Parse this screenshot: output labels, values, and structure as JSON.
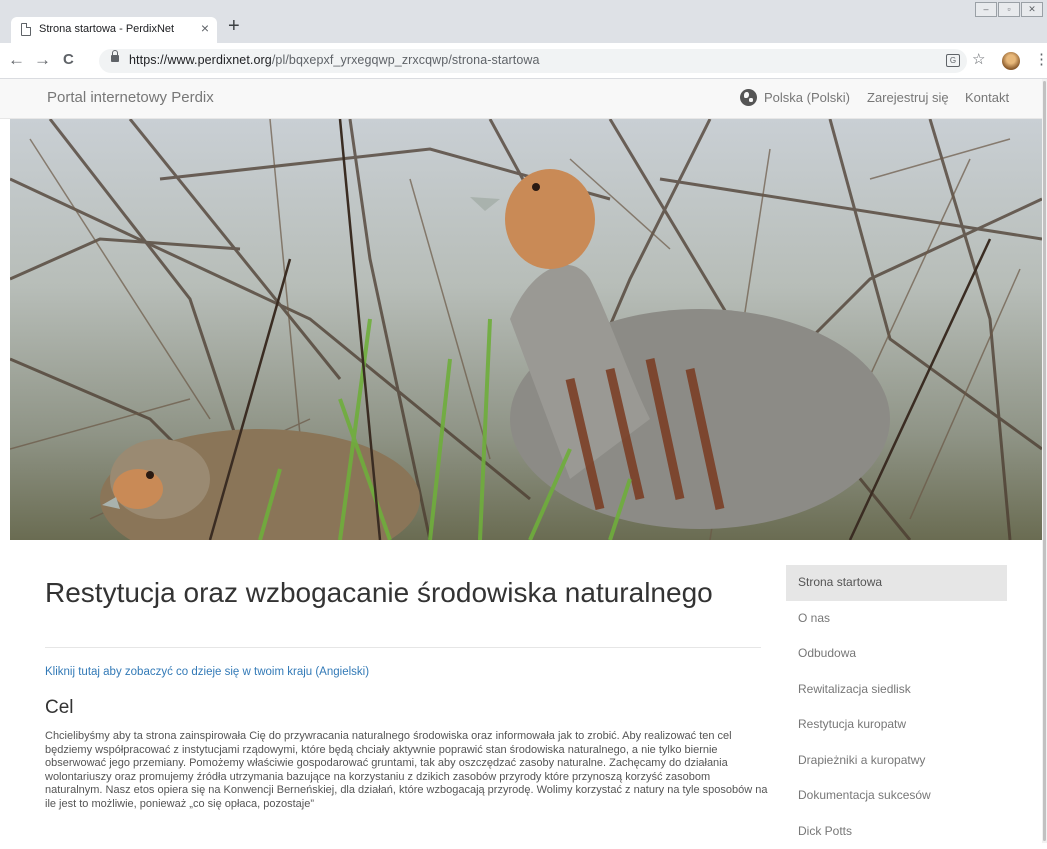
{
  "browser": {
    "tab_title": "Strona startowa - PerdixNet",
    "tab_close": "×",
    "new_tab": "+",
    "url_host": "https://www.perdixnet.org",
    "url_path": "/pl/bqxepxf_yrxegqwp_zrxcqwp/strona-startowa",
    "nav": {
      "back": "←",
      "forward": "→",
      "reload": "C"
    },
    "icons": {
      "star": "☆",
      "menu": "⋮",
      "translate": "G"
    }
  },
  "site": {
    "brand": "Portal internetowy Perdix",
    "nav": {
      "language": "Polska (Polski)",
      "register": "Zarejestruj się",
      "contact": "Kontakt"
    }
  },
  "main": {
    "title": "Restytucja oraz wzbogacanie środowiska naturalnego",
    "country_link": "Kliknij tutaj aby zobaczyć co dzieje się w twoim kraju (Angielski)",
    "section_title": "Cel",
    "body": "Chcielibyśmy aby ta strona zainspirowała Cię do przywracania naturalnego środowiska oraz informowała jak to zrobić. Aby realizować ten cel będziemy współpracować z instytucjami rządowymi, które będą chciały aktywnie poprawić stan środowiska naturalnego, a nie tylko biernie obserwować jego przemiany. Pomożemy właściwie gospodarować gruntami, tak aby oszczędzać zasoby naturalne. Zachęcamy do działania wolontariuszy oraz promujemy źródła utrzymania bazujące na korzystaniu z dzikich zasobów przyrody które przynoszą korzyść zasobom naturalnym. Nasz etos opiera się na Konwencji Berneńskiej, dla działań, które wzbogacają przyrodę. Wolimy korzystać z natury na tyle sposobów na ile jest to możliwie, ponieważ „co się opłaca, pozostaje”"
  },
  "sidebar": {
    "items": [
      {
        "label": "Strona startowa",
        "active": true
      },
      {
        "label": "O nas"
      },
      {
        "label": "Odbudowa"
      },
      {
        "label": "Rewitalizacja siedlisk"
      },
      {
        "label": "Restytucja kuropatw"
      },
      {
        "label": "Drapieżniki a kuropatwy"
      },
      {
        "label": "Dokumentacja sukcesów"
      },
      {
        "label": "Dick Potts"
      }
    ]
  },
  "colors": {
    "link": "#337ab7",
    "active_bg": "#e6e6e6",
    "navbar_bg": "#f8f8f8"
  }
}
